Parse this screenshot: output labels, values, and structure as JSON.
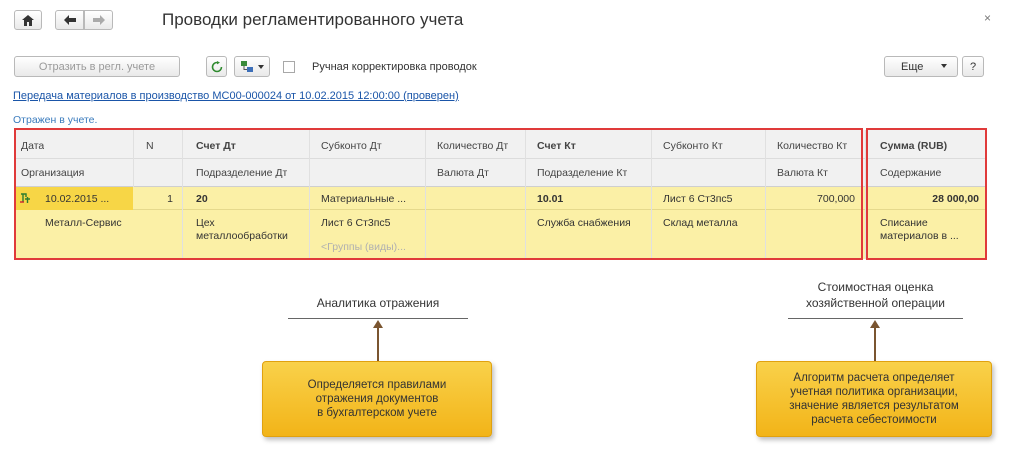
{
  "window": {
    "title": "Проводки регламентированного учета",
    "close_glyph": "×"
  },
  "toolbar": {
    "post_button": "Отразить в регл. учете",
    "manual_checkbox_label": "Ручная корректировка проводок",
    "more_button": "Еще",
    "help_button": "?"
  },
  "document_link": "Передача материалов в производство МС00-000024 от 10.02.2015 12:00:00 (проверен)",
  "status_text": "Отражен в учете.",
  "table": {
    "headers_row1": {
      "date": "Дата",
      "n": "N",
      "debit_account": "Счет Дт",
      "debit_subconto": "Субконто Дт",
      "debit_qty": "Количество Дт",
      "credit_account": "Счет Кт",
      "credit_subconto": "Субконто Кт",
      "credit_qty": "Количество Кт",
      "amount": "Сумма (RUB)"
    },
    "headers_row2": {
      "organization": "Организация",
      "debit_division": "Подразделение Дт",
      "debit_currency": "Валюта Дт",
      "credit_division": "Подразделение Кт",
      "credit_currency": "Валюта Кт",
      "content": "Содержание"
    },
    "row": {
      "date": "10.02.2015 ...",
      "n": "1",
      "debit_account": "20",
      "debit_subconto1": "Материальные ...",
      "credit_account": "10.01",
      "credit_subconto1": "Лист 6 Ст3пс5",
      "credit_qty": "700,000",
      "amount": "28 000,00",
      "organization": "Металл-Сервис",
      "debit_division_line1": "Цех",
      "debit_division_line2": "металлообработки",
      "debit_subconto2": "Лист 6 Ст3пс5",
      "debit_subconto3": "<Группы (виды)...",
      "credit_division": "Служба снабжения",
      "credit_subconto2": "Склад металла",
      "content_line1": "Списание",
      "content_line2": "материалов в ..."
    }
  },
  "annotations": {
    "left_label": "Аналитика отражения",
    "right_label_line1": "Стоимостная оценка",
    "right_label_line2": "хозяйственной операции",
    "left_callout": "Определяется правилами\nотражения документов\nв бухгалтерском учете",
    "right_callout": "Алгоритм расчета определяет\nучетная политика организации,\nзначение является результатом\nрасчета себестоимости"
  },
  "colors": {
    "highlight_row": "#fbf0a6",
    "selected_cell": "#f7d646",
    "frame_red": "#e03a3a",
    "callout_yellow": "#f2b418",
    "link_blue": "#1a55a8"
  }
}
